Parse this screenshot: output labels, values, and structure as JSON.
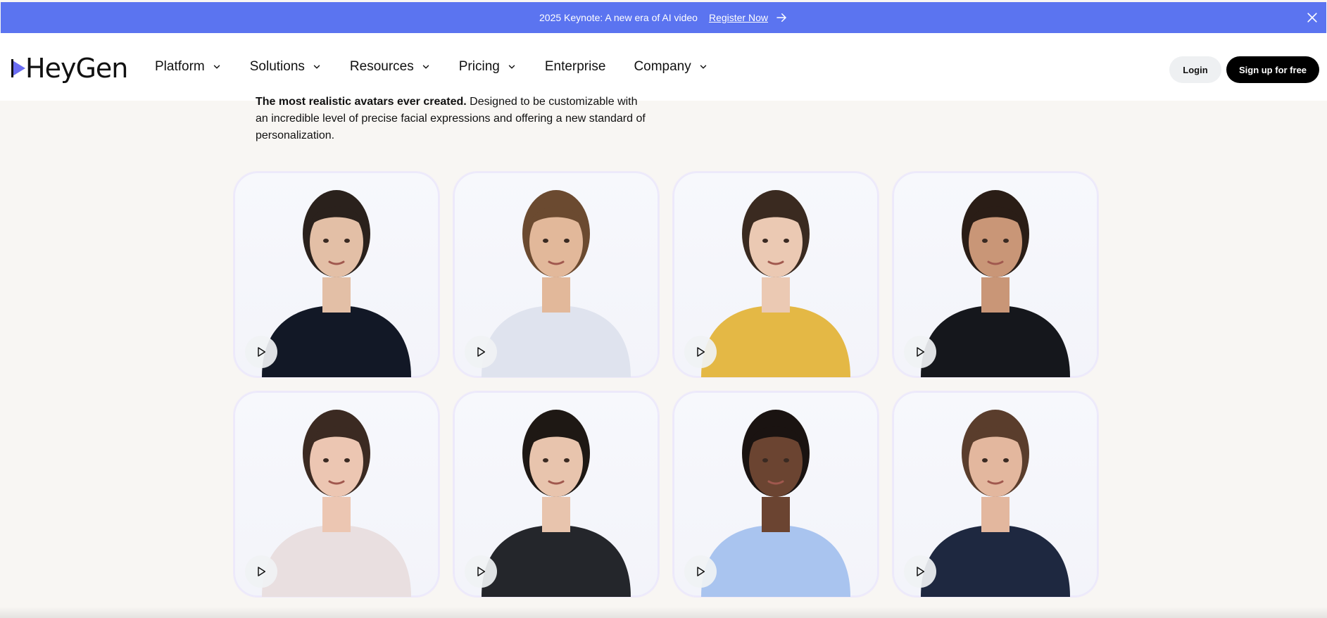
{
  "announcement": {
    "message": "2025 Keynote: A new era of AI video",
    "link_label": "Register Now",
    "bg_color": "#5b74f0"
  },
  "nav": {
    "logo_text": "HeyGen",
    "items": [
      {
        "label": "Platform",
        "has_dropdown": true
      },
      {
        "label": "Solutions",
        "has_dropdown": true
      },
      {
        "label": "Resources",
        "has_dropdown": true
      },
      {
        "label": "Pricing",
        "has_dropdown": true
      },
      {
        "label": "Enterprise",
        "has_dropdown": false
      },
      {
        "label": "Company",
        "has_dropdown": true
      }
    ],
    "login_label": "Login",
    "signup_label": "Sign up for free"
  },
  "intro": {
    "bold_text": "The most realistic avatars ever created.",
    "text": " Designed to be customizable with an incredible level of precise facial expressions and offering a new standard of personalization."
  },
  "avatars": [
    {
      "icon": "play-icon",
      "hair": "#2a211c",
      "skin": "#e3bfa6",
      "outfit": "#121826"
    },
    {
      "icon": "play-icon",
      "hair": "#6b4a30",
      "skin": "#e2b89a",
      "outfit": "#dfe3ee"
    },
    {
      "icon": "play-icon",
      "hair": "#3a2a20",
      "skin": "#ebc9b3",
      "outfit": "#e4b845"
    },
    {
      "icon": "play-icon",
      "hair": "#2a1d16",
      "skin": "#c99677",
      "outfit": "#15171c"
    },
    {
      "icon": "play-icon",
      "hair": "#3b2a22",
      "skin": "#ecc6b2",
      "outfit": "#e9dfe0"
    },
    {
      "icon": "play-icon",
      "hair": "#1e1814",
      "skin": "#e8c4ad",
      "outfit": "#24262b"
    },
    {
      "icon": "play-icon",
      "hair": "#1a1311",
      "skin": "#6b4431",
      "outfit": "#a9c4ef"
    },
    {
      "icon": "play-icon",
      "hair": "#5a3d2c",
      "skin": "#e3b79e",
      "outfit": "#1e2840"
    }
  ]
}
